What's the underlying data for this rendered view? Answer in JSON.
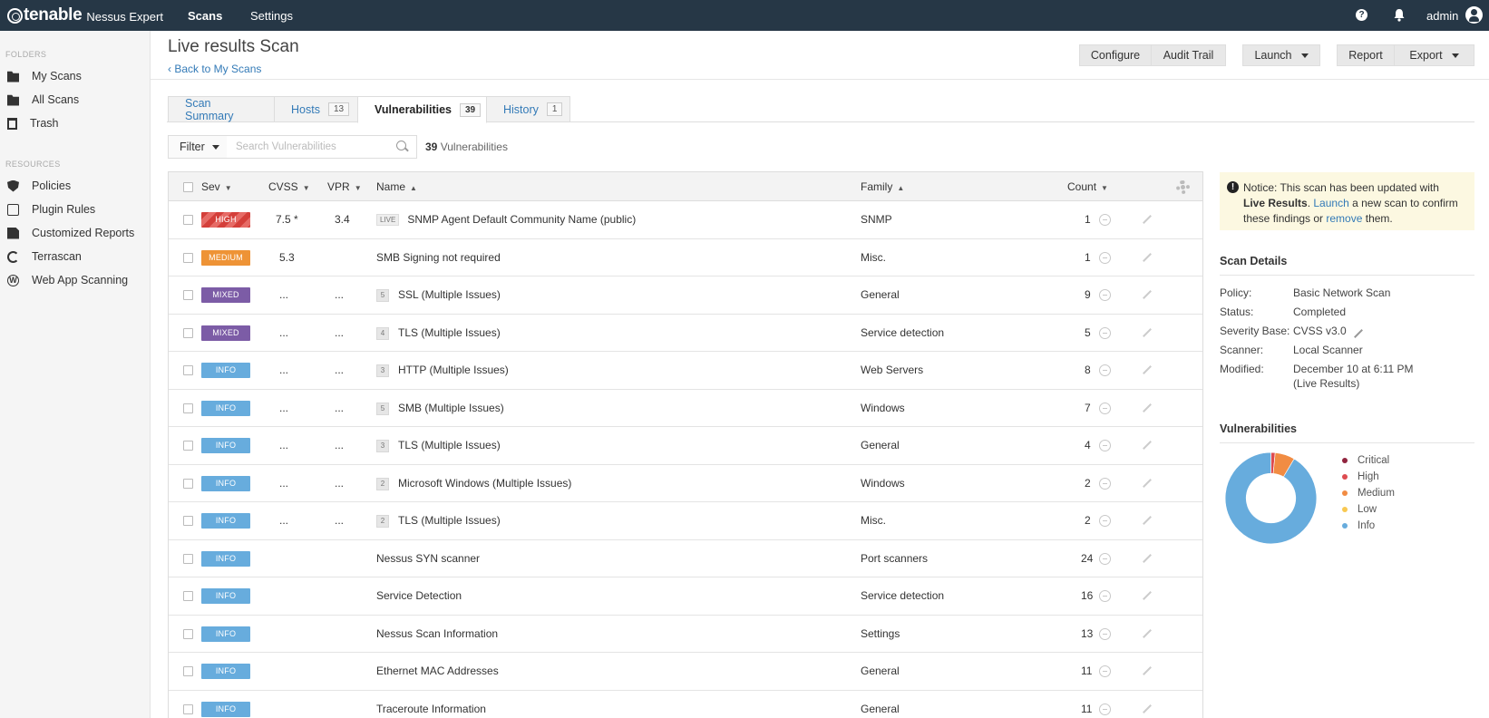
{
  "topbar": {
    "logo_word": "tenable",
    "logo_product": "Nessus Expert",
    "nav_scans": "Scans",
    "nav_settings": "Settings",
    "help_icon": "?",
    "user": "admin"
  },
  "sidebar": {
    "folders_heading": "FOLDERS",
    "folders": [
      {
        "label": "My Scans",
        "icon": "folder-icon"
      },
      {
        "label": "All Scans",
        "icon": "folder-icon"
      },
      {
        "label": "Trash",
        "icon": "trash-icon"
      }
    ],
    "resources_heading": "RESOURCES",
    "resources": [
      {
        "label": "Policies",
        "icon": "shield-icon"
      },
      {
        "label": "Plugin Rules",
        "icon": "rules-icon"
      },
      {
        "label": "Customized Reports",
        "icon": "document-icon"
      },
      {
        "label": "Terrascan",
        "icon": "terrascan-icon"
      },
      {
        "label": "Web App Scanning",
        "icon": "web-app-icon"
      }
    ]
  },
  "header": {
    "title": "Live results Scan",
    "back_link": "‹ Back to My Scans",
    "buttons": {
      "configure": "Configure",
      "audit_trail": "Audit Trail",
      "launch": "Launch",
      "report": "Report",
      "export": "Export"
    }
  },
  "tabs": [
    {
      "label": "Scan Summary",
      "count": ""
    },
    {
      "label": "Hosts",
      "count": "13"
    },
    {
      "label": "Vulnerabilities",
      "count": "39"
    },
    {
      "label": "History",
      "count": "1"
    }
  ],
  "filter": {
    "label": "Filter",
    "placeholder": "Search Vulnerabilities",
    "count_number": "39",
    "count_label": "Vulnerabilities"
  },
  "table": {
    "columns": {
      "sev": "Sev",
      "cvss": "CVSS",
      "vpr": "VPR",
      "name": "Name",
      "family": "Family",
      "count": "Count"
    },
    "sort_arrows": {
      "down": "▼",
      "up": "▲"
    },
    "rows": [
      {
        "sev": "HIGH",
        "sev_class": "high",
        "cvss": "7.5 *",
        "vpr": "3.4",
        "tag": "LIVE",
        "group": "",
        "name": "SNMP Agent Default Community Name (public)",
        "family": "SNMP",
        "count": "1"
      },
      {
        "sev": "MEDIUM",
        "sev_class": "medium",
        "cvss": "5.3",
        "vpr": "",
        "tag": "",
        "group": "",
        "name": "SMB Signing not required",
        "family": "Misc.",
        "count": "1"
      },
      {
        "sev": "MIXED",
        "sev_class": "mixed",
        "cvss": "...",
        "vpr": "...",
        "tag": "",
        "group": "5",
        "name": "SSL (Multiple Issues)",
        "family": "General",
        "count": "9"
      },
      {
        "sev": "MIXED",
        "sev_class": "mixed",
        "cvss": "...",
        "vpr": "...",
        "tag": "",
        "group": "4",
        "name": "TLS (Multiple Issues)",
        "family": "Service detection",
        "count": "5"
      },
      {
        "sev": "INFO",
        "sev_class": "info",
        "cvss": "...",
        "vpr": "...",
        "tag": "",
        "group": "3",
        "name": "HTTP (Multiple Issues)",
        "family": "Web Servers",
        "count": "8"
      },
      {
        "sev": "INFO",
        "sev_class": "info",
        "cvss": "...",
        "vpr": "...",
        "tag": "",
        "group": "5",
        "name": "SMB (Multiple Issues)",
        "family": "Windows",
        "count": "7"
      },
      {
        "sev": "INFO",
        "sev_class": "info",
        "cvss": "...",
        "vpr": "...",
        "tag": "",
        "group": "3",
        "name": "TLS (Multiple Issues)",
        "family": "General",
        "count": "4"
      },
      {
        "sev": "INFO",
        "sev_class": "info",
        "cvss": "...",
        "vpr": "...",
        "tag": "",
        "group": "2",
        "name": "Microsoft Windows (Multiple Issues)",
        "family": "Windows",
        "count": "2"
      },
      {
        "sev": "INFO",
        "sev_class": "info",
        "cvss": "...",
        "vpr": "...",
        "tag": "",
        "group": "2",
        "name": "TLS (Multiple Issues)",
        "family": "Misc.",
        "count": "2"
      },
      {
        "sev": "INFO",
        "sev_class": "info",
        "cvss": "",
        "vpr": "",
        "tag": "",
        "group": "",
        "name": "Nessus SYN scanner",
        "family": "Port scanners",
        "count": "24"
      },
      {
        "sev": "INFO",
        "sev_class": "info",
        "cvss": "",
        "vpr": "",
        "tag": "",
        "group": "",
        "name": "Service Detection",
        "family": "Service detection",
        "count": "16"
      },
      {
        "sev": "INFO",
        "sev_class": "info",
        "cvss": "",
        "vpr": "",
        "tag": "",
        "group": "",
        "name": "Nessus Scan Information",
        "family": "Settings",
        "count": "13"
      },
      {
        "sev": "INFO",
        "sev_class": "info",
        "cvss": "",
        "vpr": "",
        "tag": "",
        "group": "",
        "name": "Ethernet MAC Addresses",
        "family": "General",
        "count": "11"
      },
      {
        "sev": "INFO",
        "sev_class": "info",
        "cvss": "",
        "vpr": "",
        "tag": "",
        "group": "",
        "name": "Traceroute Information",
        "family": "General",
        "count": "11"
      }
    ]
  },
  "notice": {
    "icon": "!",
    "prefix": "Notice: This scan has been updated with ",
    "bold": "Live Results",
    "sep": ". ",
    "launch_link": "Launch",
    "middle": " a new scan to confirm these findings or ",
    "remove_link": "remove",
    "suffix": " them."
  },
  "scan_details": {
    "heading": "Scan Details",
    "items": [
      {
        "label": "Policy:",
        "value": "Basic Network Scan"
      },
      {
        "label": "Status:",
        "value": "Completed"
      },
      {
        "label": "Severity Base:",
        "value": "CVSS v3.0"
      },
      {
        "label": "Scanner:",
        "value": "Local Scanner"
      },
      {
        "label": "Modified:",
        "value": "December 10 at 6:11 PM (Live Results)"
      }
    ]
  },
  "vulnerabilities_panel": {
    "heading": "Vulnerabilities",
    "legend": [
      {
        "label": "Critical",
        "color": "#91243e"
      },
      {
        "label": "High",
        "color": "#dd4b50"
      },
      {
        "label": "Medium",
        "color": "#f18c43"
      },
      {
        "label": "Low",
        "color": "#f8c851"
      },
      {
        "label": "Info",
        "color": "#67acdd"
      }
    ],
    "donut_fractions": {
      "critical": 0,
      "high": 0.015,
      "medium": 0.07,
      "low": 0,
      "info": 0.915
    }
  },
  "colors": {
    "topbar": "#263746",
    "link": "#337ab7",
    "sev_high": "#d43f3a",
    "sev_medium": "#ee9336",
    "sev_mixed": "#7c5ca6",
    "sev_info": "#67acdd"
  }
}
